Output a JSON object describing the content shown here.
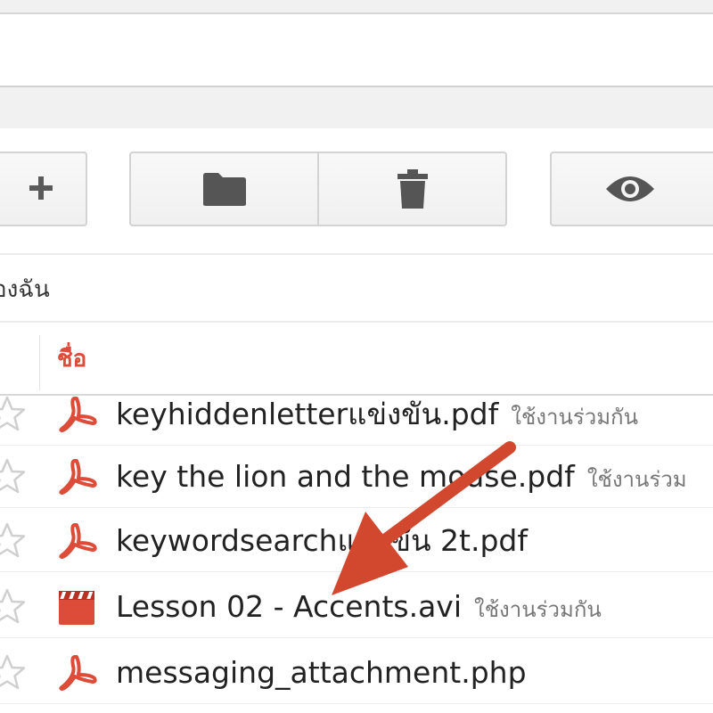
{
  "toolbar": {
    "new_icon": "add-icon",
    "folder_icon": "folder-icon",
    "trash_icon": "trash-icon",
    "view_icon": "eye-icon"
  },
  "breadcrumb": {
    "label": "องฉัน"
  },
  "columns": {
    "name_header": "ชื่อ"
  },
  "files": [
    {
      "name": "keyhiddenletterแข่งขัน.pdf",
      "shared": "ใช้งานร่วมกัน",
      "type": "pdf",
      "icon": "pdf-icon"
    },
    {
      "name": "key the lion and the mouse.pdf",
      "shared": "ใช้งานร่วม",
      "type": "pdf",
      "icon": "pdf-icon"
    },
    {
      "name": "keywordsearchแข่งขัน 2t.pdf",
      "shared": "",
      "type": "pdf",
      "icon": "pdf-icon"
    },
    {
      "name": "Lesson 02 - Accents.avi",
      "shared": "ใช้งานร่วมกัน",
      "type": "video",
      "icon": "video-icon"
    },
    {
      "name": "messaging_attachment.php",
      "shared": "",
      "type": "pdf",
      "icon": "pdf-icon"
    }
  ],
  "colors": {
    "accent_red": "#dd4b39",
    "annotation_arrow": "#d2482f"
  }
}
